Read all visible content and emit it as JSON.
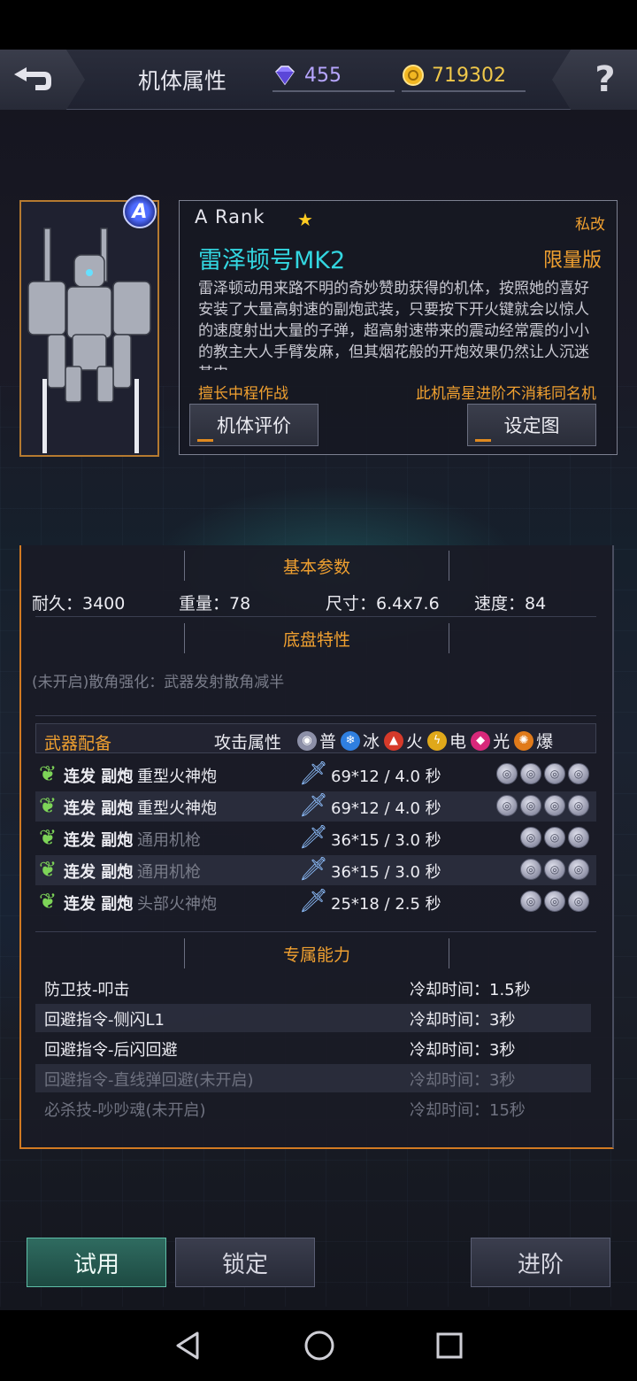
{
  "header": {
    "title": "机体属性",
    "gems": "455",
    "coins": "719302"
  },
  "mech": {
    "rank_badge": "A",
    "rank": "A Rank",
    "private_tag": "私改",
    "name": "雷泽顿号MK2",
    "edition": "限量版",
    "description": "雷泽顿动用来路不明的奇妙赞助获得的机体，按照她的喜好安装了大量高射速的副炮武装，只要按下开火键就会以惊人的速度射出大量的子弹，超高射速带来的震动经常震的小小的教主大人手臂发麻，但其烟花般的开炮效果仍然让人沉迷其中。",
    "strength": "擅长中程作战",
    "upgrade_note": "此机高星进阶不消耗同名机",
    "review_button": "机体评价",
    "setting_button": "设定图"
  },
  "basic": {
    "title": "基本参数",
    "durability": "耐久：3400",
    "weight": "重量：78",
    "size": "尺寸：6.4x7.6",
    "speed": "速度：84"
  },
  "chassis": {
    "title": "底盘特性",
    "trait": "(未开启)散角强化：武器发射散角减半"
  },
  "weapons": {
    "header": "武器配备",
    "attr_label": "攻击属性",
    "elements": [
      {
        "name": "普",
        "color": "#8d90a8",
        "glyph": "◉"
      },
      {
        "name": "冰",
        "color": "#2f7fe0",
        "glyph": "❄"
      },
      {
        "name": "火",
        "color": "#d63a2a",
        "glyph": "▲"
      },
      {
        "name": "电",
        "color": "#e0a81a",
        "glyph": "ϟ"
      },
      {
        "name": "光",
        "color": "#d8287a",
        "glyph": "◆"
      },
      {
        "name": "爆",
        "color": "#e07a1a",
        "glyph": "✺"
      }
    ],
    "rows": [
      {
        "type": "连发 副炮",
        "name": "重型火神炮",
        "damage": "69*12 / 4.0 秒",
        "slots": 4,
        "dim": false
      },
      {
        "type": "连发 副炮",
        "name": "重型火神炮",
        "damage": "69*12 / 4.0 秒",
        "slots": 4,
        "dim": false
      },
      {
        "type": "连发 副炮",
        "name": "通用机枪",
        "damage": "36*15 / 3.0 秒",
        "slots": 3,
        "dim": true
      },
      {
        "type": "连发 副炮",
        "name": "通用机枪",
        "damage": "36*15 / 3.0 秒",
        "slots": 3,
        "dim": true
      },
      {
        "type": "连发 副炮",
        "name": "头部火神炮",
        "damage": "25*18 / 2.5 秒",
        "slots": 3,
        "dim": true
      }
    ]
  },
  "skills": {
    "title": "专属能力",
    "rows": [
      {
        "name": "防卫技-叩击",
        "cooldown": "冷却时间：1.5秒",
        "locked": false
      },
      {
        "name": "回避指令-侧闪L1",
        "cooldown": "冷却时间：3秒",
        "locked": false
      },
      {
        "name": "回避指令-后闪回避",
        "cooldown": "冷却时间：3秒",
        "locked": false
      },
      {
        "name": "回避指令-直线弹回避(未开启)",
        "cooldown": "冷却时间：3秒",
        "locked": true
      },
      {
        "name": "必杀技-吵吵魂(未开启)",
        "cooldown": "冷却时间：15秒",
        "locked": true
      }
    ]
  },
  "buttons": {
    "trial": "试用",
    "lock": "锁定",
    "advance": "进阶"
  },
  "colors": {
    "accent_orange": "#f0a030",
    "name_cyan": "#33d6e0",
    "frame_orange": "#d27a22"
  }
}
